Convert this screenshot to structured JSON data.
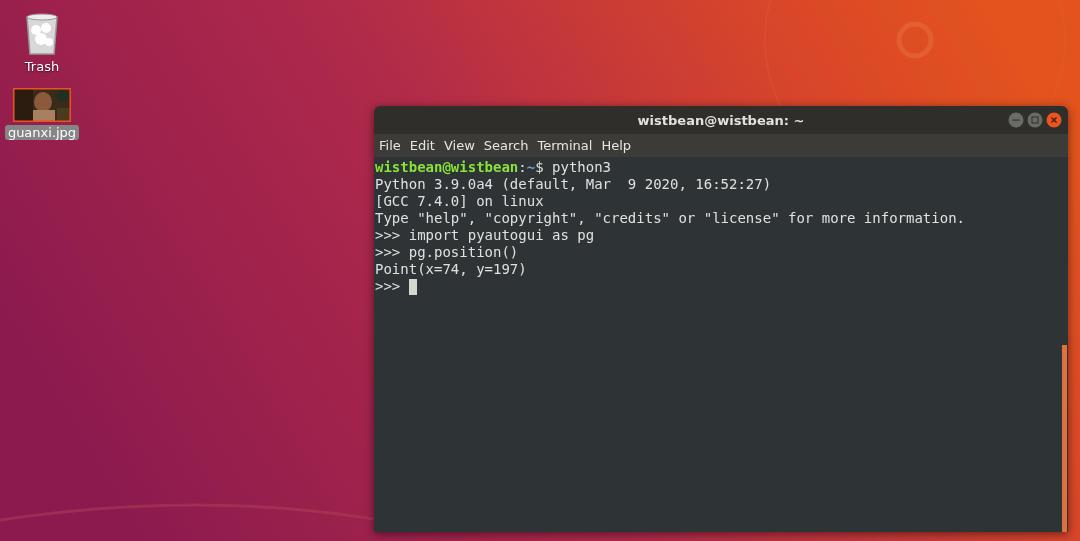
{
  "desktop_icons": [
    {
      "kind": "trash",
      "label": "Trash",
      "selected": false
    },
    {
      "label": "guanxi.jpg",
      "selected": true
    }
  ],
  "window": {
    "title": "wistbean@wistbean: ~"
  },
  "menu": [
    "File",
    "Edit",
    "View",
    "Search",
    "Terminal",
    "Help"
  ],
  "terminal_lines": [
    {
      "kind": "shell_prompt",
      "user_host": "wistbean@wistbean",
      "separator": ":",
      "path": "~",
      "command": "$ python3"
    },
    {
      "kind": "output",
      "text": "Python 3.9.0a4 (default, Mar  9 2020, 16:52:27)"
    },
    {
      "kind": "output",
      "text": "[GCC 7.4.0] on linux"
    },
    {
      "kind": "output",
      "text": "Type \"help\", \"copyright\", \"credits\" or \"license\" for more information."
    },
    {
      "kind": "output",
      "text": ">>> import pyautogui as pg"
    },
    {
      "kind": "output",
      "text": ">>> pg.position()"
    },
    {
      "kind": "output",
      "text": "Point(x=74, y=197)"
    },
    {
      "kind": "python_prompt",
      "text": ">>>",
      "cursor": true
    }
  ]
}
